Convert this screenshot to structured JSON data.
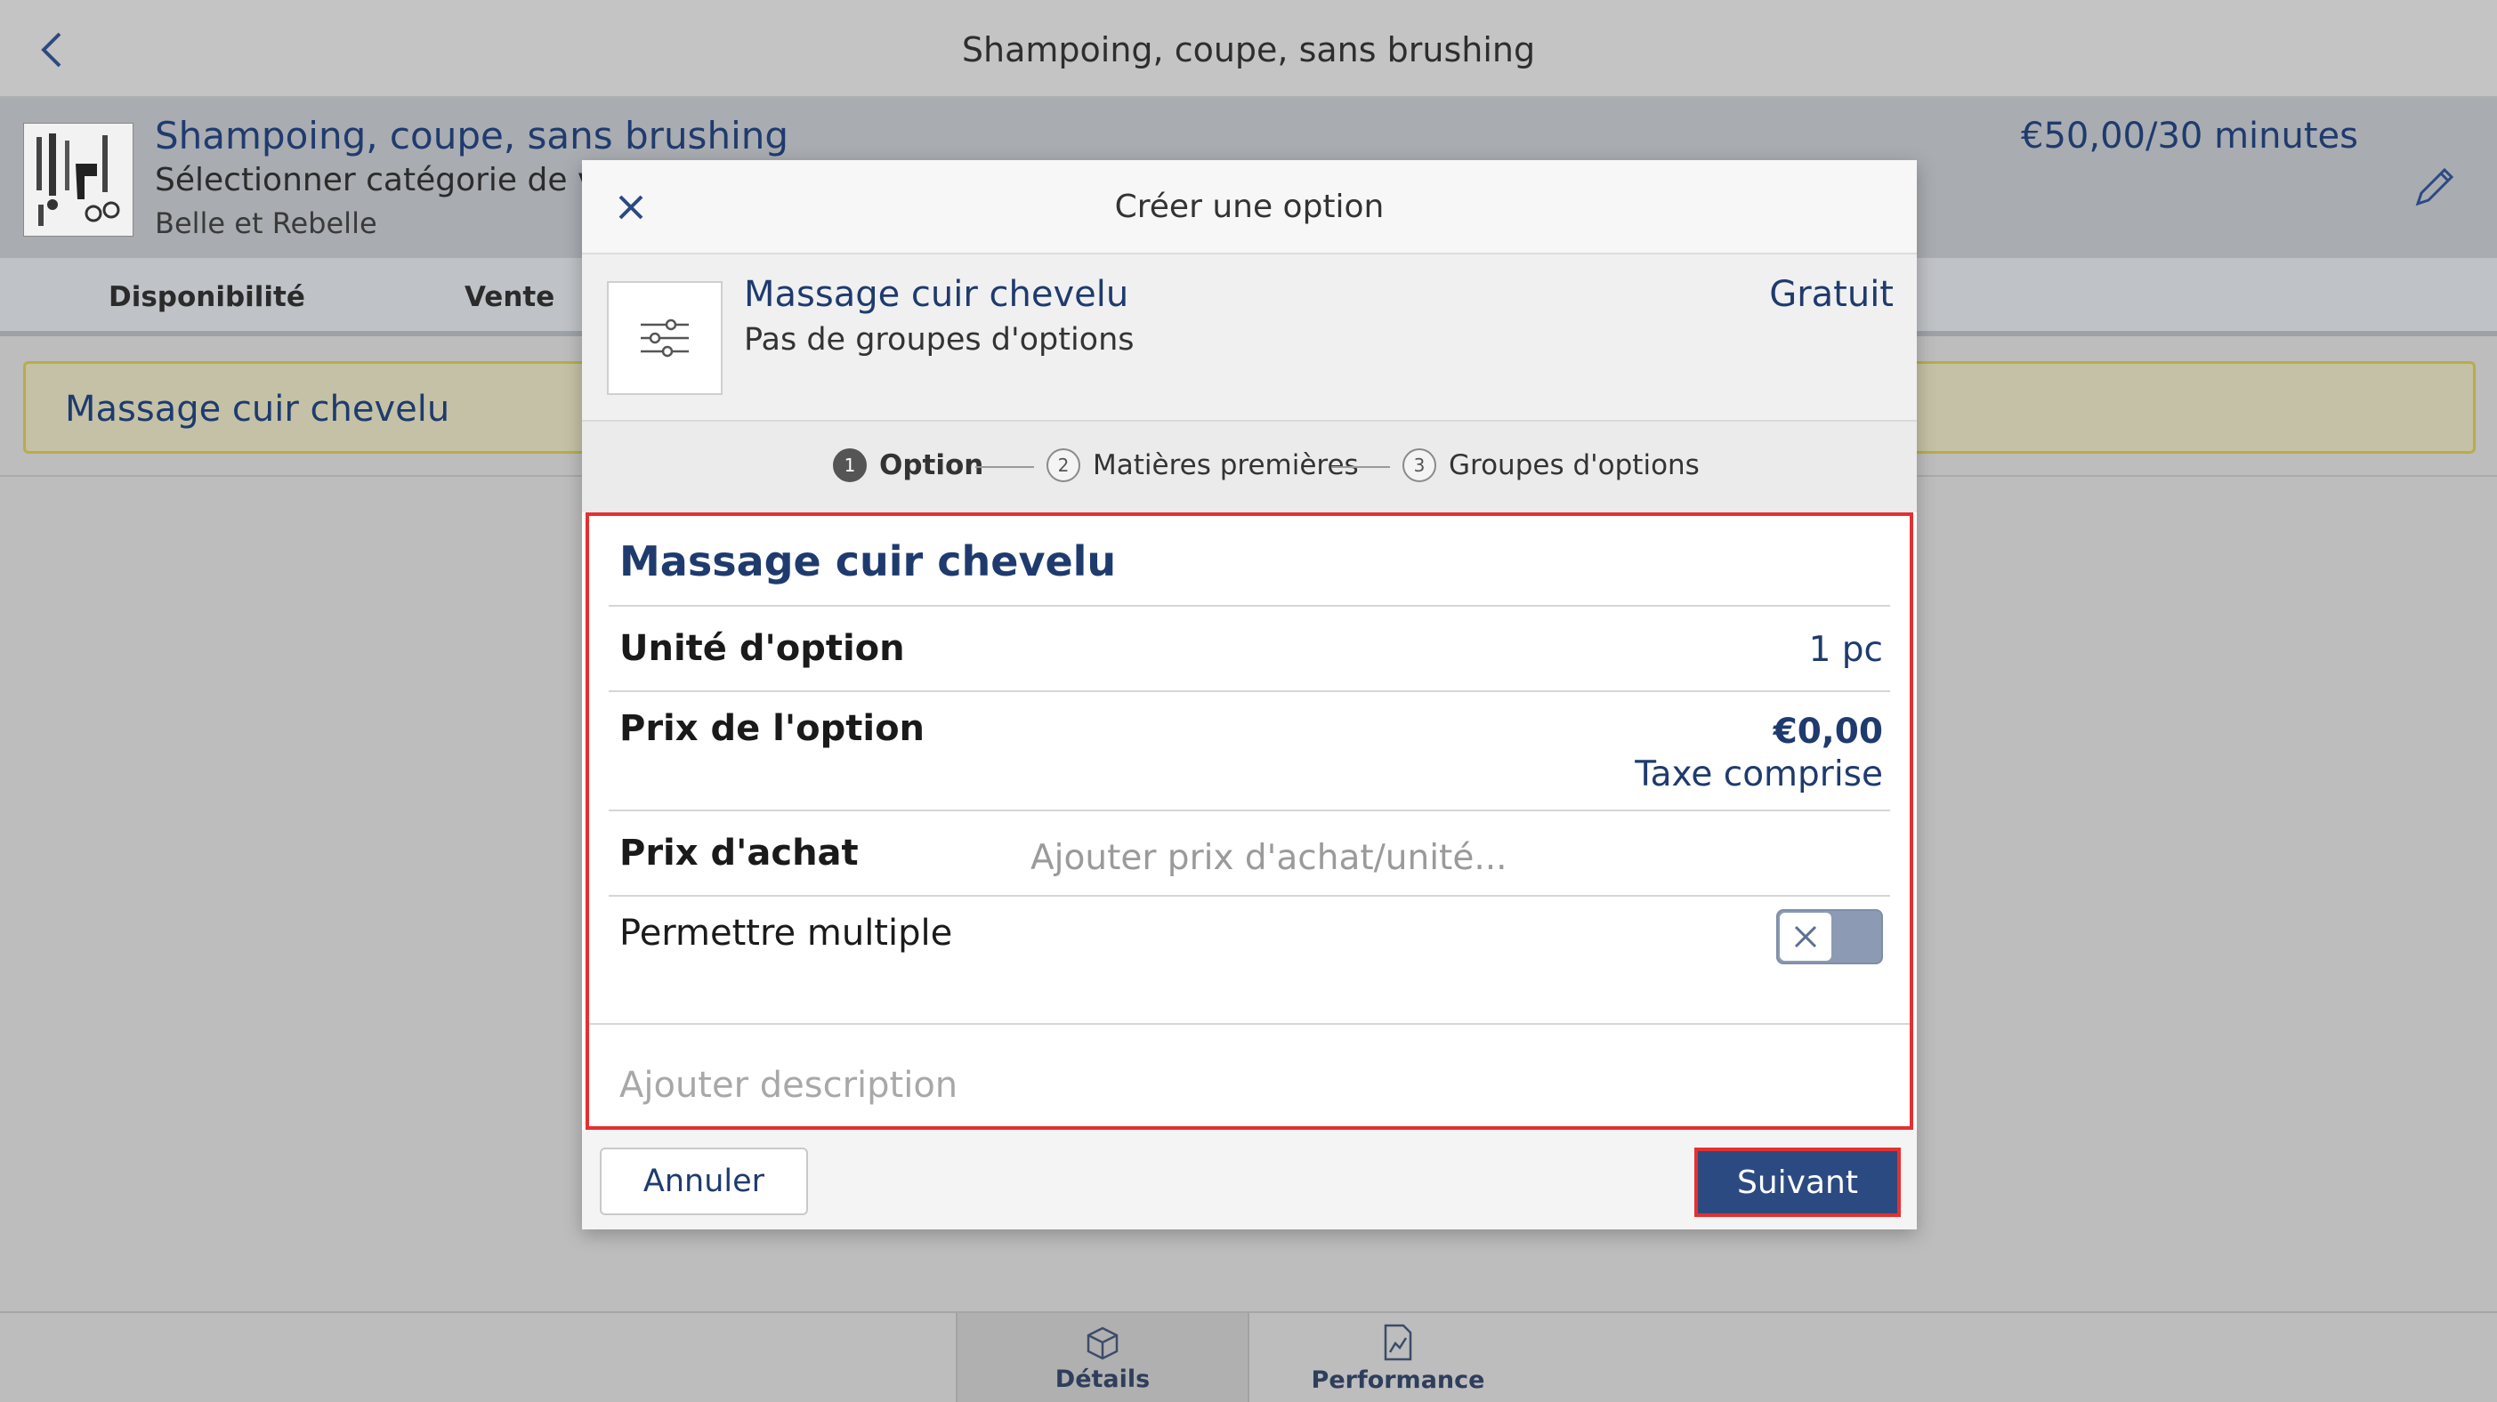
{
  "topbar": {
    "title": "Shampoing, coupe, sans brushing",
    "back_icon": "chevron-left-icon"
  },
  "service": {
    "name": "Shampoing, coupe, sans brushing",
    "category": "Sélectionner catégorie de vente",
    "brand": "Belle et Rebelle",
    "price_duration": "€50,00/30 minutes",
    "edit_icon": "pencil-icon"
  },
  "tabs": [
    "Disponibilité",
    "Vente"
  ],
  "option_row": {
    "name": "Massage cuir chevelu"
  },
  "modal": {
    "title": "Créer une option",
    "close_icon": "close-icon",
    "summary": {
      "name": "Massage cuir chevelu",
      "subtitle": "Pas de groupes d'options",
      "price": "Gratuit",
      "icon": "sliders-icon"
    },
    "steps": [
      {
        "number": "1",
        "label": "Option",
        "active": true
      },
      {
        "number": "2",
        "label": "Matières premières",
        "active": false
      },
      {
        "number": "3",
        "label": "Groupes d'options",
        "active": false
      }
    ],
    "form": {
      "title": "Massage cuir chevelu",
      "unit_label": "Unité d'option",
      "unit_value": "1 pc",
      "price_label": "Prix de l'option",
      "price_value": "€0,00",
      "price_note": "Taxe comprise",
      "purchase_label": "Prix d'achat",
      "purchase_placeholder": "Ajouter prix d'achat/unité...",
      "multiple_label": "Permettre multiple",
      "multiple_enabled": false,
      "description_placeholder": "Ajouter description"
    },
    "cancel_label": "Annuler",
    "next_label": "Suivant"
  },
  "bottom_nav": [
    {
      "label": "Détails",
      "icon": "box-icon",
      "active": true
    },
    {
      "label": "Performance",
      "icon": "chart-document-icon",
      "active": false
    }
  ],
  "colors": {
    "accent": "#2c4a82",
    "text_primary": "#1f3b6e",
    "highlight": "#e53030",
    "selected_row": "#b9ad48"
  }
}
